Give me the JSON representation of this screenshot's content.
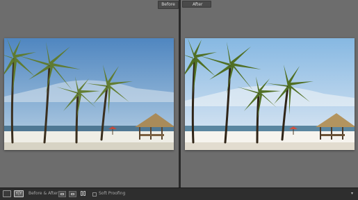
{
  "panes": {
    "before": {
      "label": "Before"
    },
    "after": {
      "label": "After"
    }
  },
  "toolbar": {
    "mode_label": "Before & After :",
    "soft_proofing_label": "Soft Proofing",
    "view_loupe_glyph": "",
    "view_compare_glyph": "Y|Y"
  },
  "colors": {
    "background": "#6e6e6e",
    "toolbar": "#2e2e2e",
    "divider": "#2a2a2a",
    "before_sky_top": "#6aa0d4",
    "before_sky_bottom": "#bfd2e4",
    "after_sky_top": "#8fbfe4",
    "after_sky_bottom": "#d6e6f1"
  },
  "icons": [
    "loupe-view-icon",
    "before-after-view-icon",
    "copy-before-to-after-icon",
    "copy-after-to-before-icon",
    "swap-icon",
    "checkbox-icon",
    "chevron-down-icon"
  ]
}
